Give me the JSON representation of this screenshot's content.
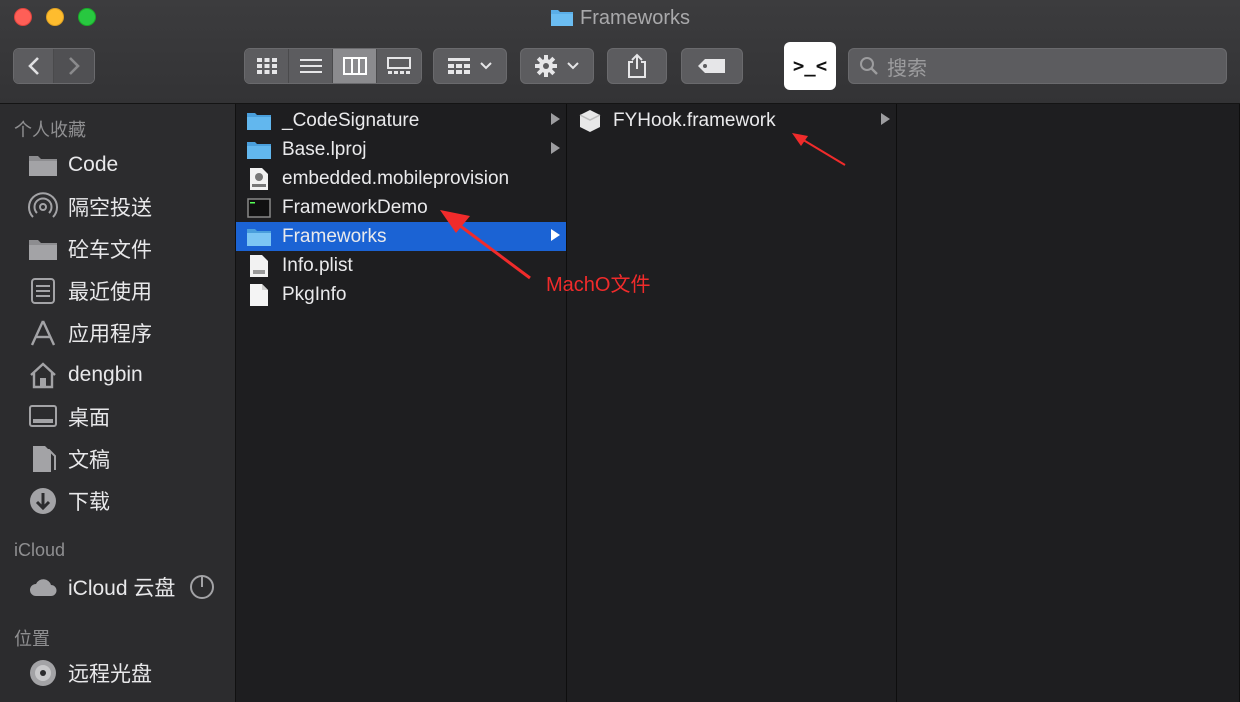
{
  "window": {
    "title": "Frameworks",
    "title_icon": "folder-icon"
  },
  "toolbar": {
    "back_icon": "chevron-left-icon",
    "forward_icon": "chevron-right-icon",
    "view_modes": [
      "icon-view",
      "list-view",
      "column-view",
      "gallery-view"
    ],
    "selected_view": "column-view",
    "group_icon": "group-grid-icon",
    "action_icon": "gear-icon",
    "share_icon": "share-icon",
    "tag_icon": "tag-icon",
    "terminal_label": ">_<",
    "search_placeholder": "搜索"
  },
  "sidebar": {
    "favorites_title": "个人收藏",
    "favorites": [
      {
        "label": "Code",
        "icon": "folder-icon"
      },
      {
        "label": "隔空投送",
        "icon": "airdrop-icon"
      },
      {
        "label": "砼车文件",
        "icon": "folder-icon"
      },
      {
        "label": "最近使用",
        "icon": "recents-icon"
      },
      {
        "label": "应用程序",
        "icon": "applications-icon"
      },
      {
        "label": "dengbin",
        "icon": "home-icon"
      },
      {
        "label": "桌面",
        "icon": "desktop-icon"
      },
      {
        "label": "文稿",
        "icon": "documents-icon"
      },
      {
        "label": "下载",
        "icon": "download-icon"
      }
    ],
    "icloud_title": "iCloud",
    "icloud": [
      {
        "label": "iCloud 云盘",
        "icon": "cloud-icon",
        "status_icon": "progress-ring-icon"
      }
    ],
    "locations_title": "位置",
    "locations": [
      {
        "label": "远程光盘",
        "icon": "disc-icon"
      }
    ]
  },
  "columns": {
    "col1": [
      {
        "name": "_CodeSignature",
        "icon": "folder-icon",
        "has_children": true
      },
      {
        "name": "Base.lproj",
        "icon": "folder-icon",
        "has_children": true
      },
      {
        "name": "embedded.mobileprovision",
        "icon": "provision-file-icon",
        "has_children": false
      },
      {
        "name": "FrameworkDemo",
        "icon": "executable-icon",
        "has_children": false
      },
      {
        "name": "Frameworks",
        "icon": "folder-icon",
        "has_children": true,
        "selected": true
      },
      {
        "name": "Info.plist",
        "icon": "plist-file-icon",
        "has_children": false
      },
      {
        "name": "PkgInfo",
        "icon": "document-icon",
        "has_children": false
      }
    ],
    "col2": [
      {
        "name": "FYHook.framework",
        "icon": "framework-icon",
        "has_children": true
      }
    ]
  },
  "annotations": {
    "macho_label": "MachO文件",
    "color": "#f02b2b"
  },
  "colors": {
    "selection": "#1b63d4",
    "folder": "#5aaee8"
  }
}
